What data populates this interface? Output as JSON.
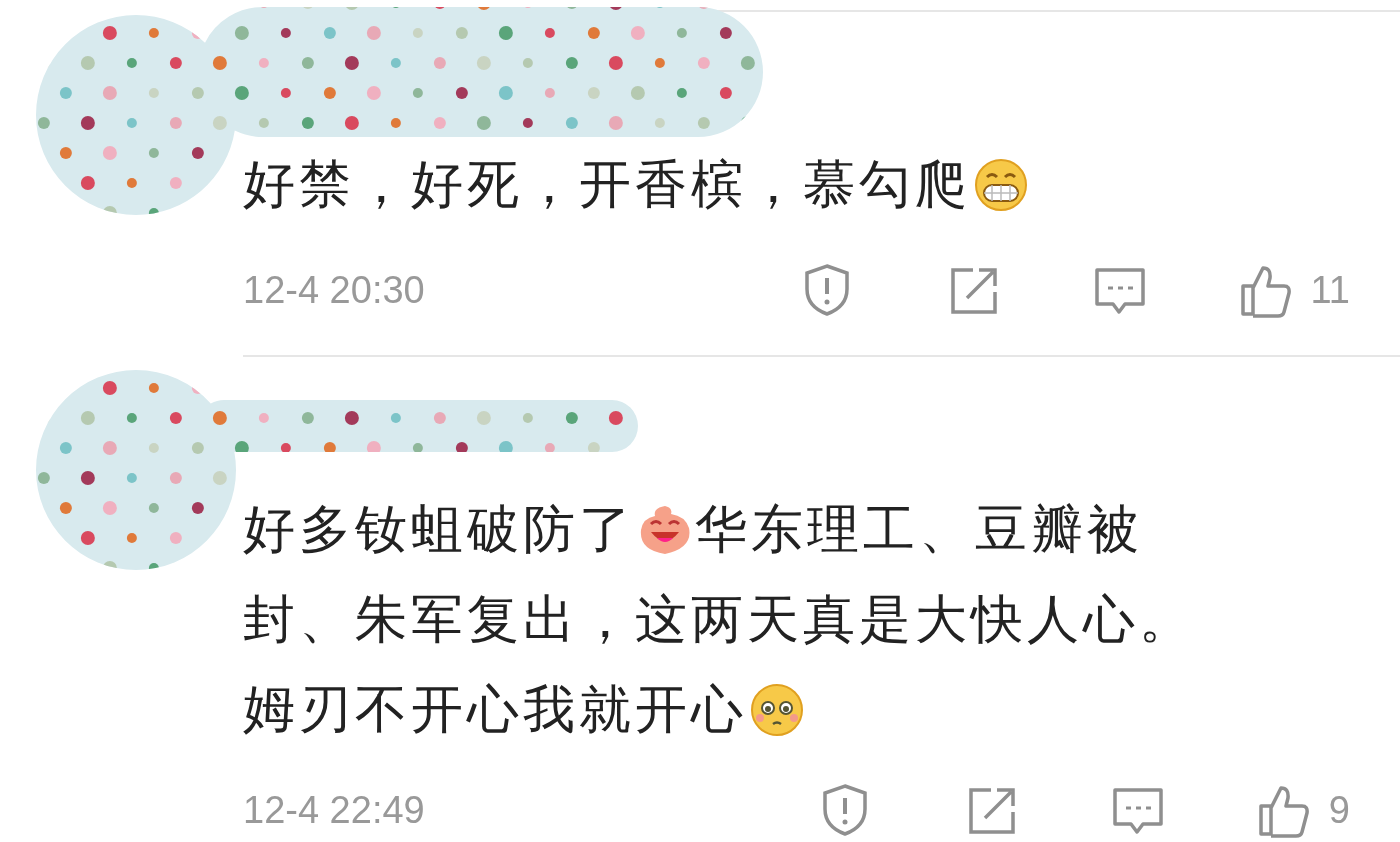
{
  "comments": [
    {
      "lines": [
        [
          {
            "kind": "text",
            "text": "好禁，好死，开香槟，慕勾爬"
          },
          {
            "kind": "grin"
          }
        ]
      ],
      "time": "12-4 20:30",
      "likes": "11"
    },
    {
      "lines": [
        [
          {
            "kind": "text",
            "text": "好多钕蛆破防了"
          },
          {
            "kind": "laugh"
          },
          {
            "kind": "text",
            "text": "华东理工、豆瓣被"
          }
        ],
        [
          {
            "kind": "text",
            "text": "封、朱军复出，这两天真是大快人心。"
          }
        ],
        [
          {
            "kind": "text",
            "text": "姆刃不开心我就开心"
          },
          {
            "kind": "shy"
          }
        ]
      ],
      "time": "12-4 22:49",
      "likes": "9"
    }
  ]
}
